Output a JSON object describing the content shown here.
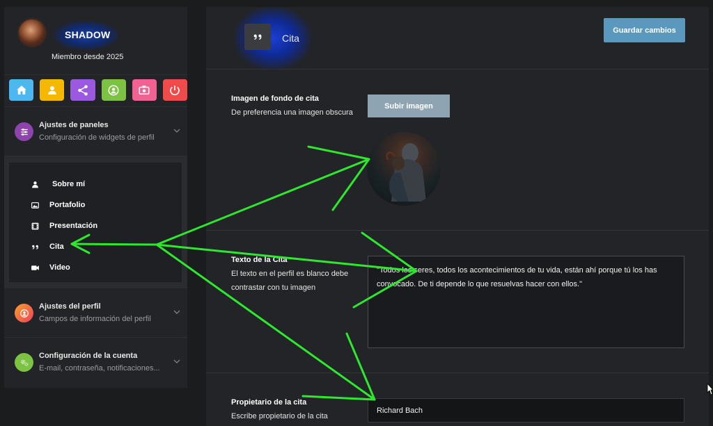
{
  "sidebar": {
    "username": "SHADOW",
    "member_since": "Miembro desde 2025",
    "quick_actions": [
      {
        "icon": "home-icon",
        "color": "#4db8f0"
      },
      {
        "icon": "user-icon",
        "color": "#f5b700"
      },
      {
        "icon": "share-icon",
        "color": "#9b59e0"
      },
      {
        "icon": "account-circle-icon",
        "color": "#7cc243"
      },
      {
        "icon": "id-card-icon",
        "color": "#f06292"
      },
      {
        "icon": "power-icon",
        "color": "#ef4b4b"
      }
    ],
    "sections": [
      {
        "title": "Ajustes de paneles",
        "subtitle": "Configuración de widgets de perfil",
        "icon": "sliders-icon",
        "color": "#8e44ad"
      },
      {
        "title": "Ajustes del perfil",
        "subtitle": "Campos de información del perfil",
        "icon": "profile-icon",
        "color": "#f25c30"
      },
      {
        "title": "Configuración de la cuenta",
        "subtitle": "E-mail, contraseña, notificaciones...",
        "icon": "cogs-icon",
        "color": "#7cc243"
      }
    ],
    "submenu": [
      {
        "label": "Sobre mí",
        "icon": "user-icon"
      },
      {
        "label": "Portafolio",
        "icon": "gallery-icon"
      },
      {
        "label": "Presentación",
        "icon": "film-icon"
      },
      {
        "label": "Cita",
        "icon": "quote-icon"
      },
      {
        "label": "Video",
        "icon": "video-camera-icon"
      }
    ]
  },
  "main": {
    "title": "Cita",
    "save_label": "Guardar cambios",
    "background": {
      "label": "Imagen de fondo de cita",
      "description": "De preferencia una imagen obscura",
      "upload_label": "Subir imagen"
    },
    "quote_text": {
      "label": "Texto de la Cita",
      "description": "El texto en el perfil es blanco debe contrastar con tu imagen",
      "value": "\"Todos los seres, todos los acontecimientos de tu vida, están ahí porque tú los has convocado. De ti depende lo que resuelvas hacer con ellos.\""
    },
    "owner": {
      "label": "Propietario de la cita",
      "description": "Escribe propietario de la cita",
      "value": "Richard Bach"
    }
  },
  "colors": {
    "annotation_arrows": "#2de82d",
    "accent_button": "#5b98be"
  }
}
